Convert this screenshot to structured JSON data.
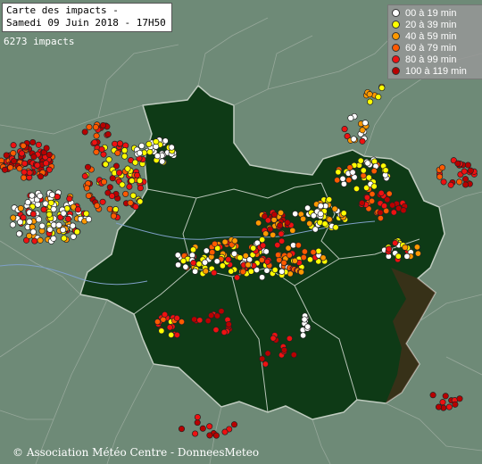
{
  "title": {
    "line1": "Carte des impacts -",
    "line2": "Samedi 09 Juin 2018 - 17H50"
  },
  "impact_count": "6273 impacts",
  "legend": [
    {
      "label": "00 à 19 min",
      "color": "#ffffff"
    },
    {
      "label": "20 à 39 min",
      "color": "#ffff00"
    },
    {
      "label": "40 à 59 min",
      "color": "#ff9900"
    },
    {
      "label": "60 à 79 min",
      "color": "#ff5a00"
    },
    {
      "label": "80 à 99 min",
      "color": "#ee1111"
    },
    {
      "label": "100 à 119 min",
      "color": "#b80000"
    }
  ],
  "credit": "© Association Météo Centre - DonneesMeteo"
}
